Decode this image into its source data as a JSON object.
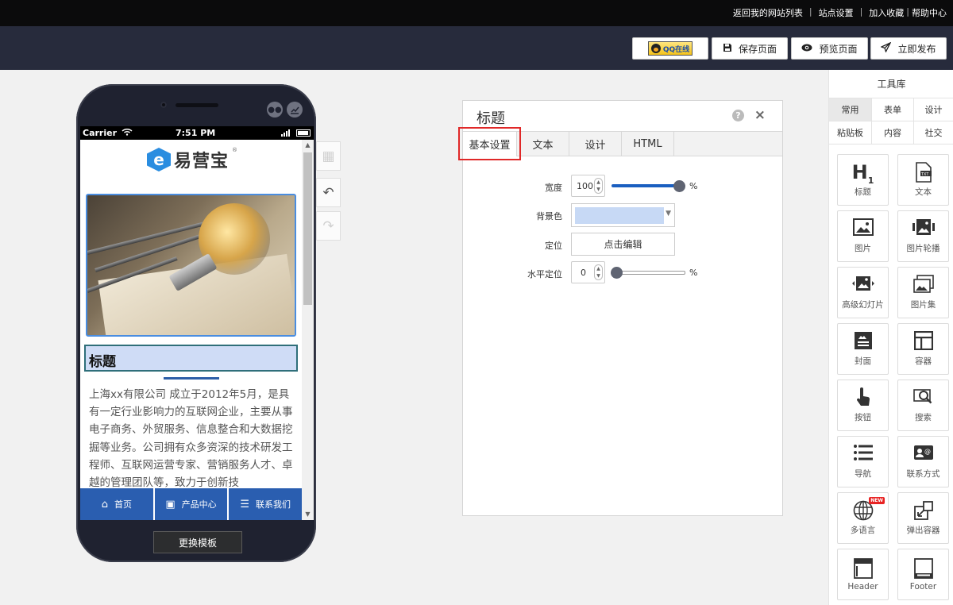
{
  "topbar": {
    "links": [
      "返回我的网站列表",
      "站点设置",
      "加入收藏",
      "帮助中心"
    ]
  },
  "navbar": {
    "qq_label": "QQ在线",
    "save_label": "保存页面",
    "preview_label": "预览页面",
    "publish_label": "立即发布"
  },
  "phone": {
    "carrier": "Carrier",
    "time": "7:51 PM",
    "logo_text": "易营宝",
    "logo_reg": "®",
    "title": "标题",
    "body": "上海xx有限公司 成立于2012年5月，是具有一定行业影响力的互联网企业，主要从事电子商务、外贸服务、信息整合和大数据挖掘等业务。公司拥有众多资深的技术研发工程师、互联网运营专家、营销服务人才、卓越的管理团队等，致力于创新技",
    "tabs": [
      {
        "label": "首页",
        "icon": "home-icon"
      },
      {
        "label": "产品中心",
        "icon": "gallery-icon"
      },
      {
        "label": "联系我们",
        "icon": "list-icon"
      }
    ],
    "change_template_label": "更换模板"
  },
  "panel": {
    "title": "标题",
    "tabs": [
      "基本设置",
      "文本",
      "设计",
      "HTML"
    ],
    "active_tab": "基本设置",
    "width_label": "宽度",
    "width_value": "100",
    "width_unit": "%",
    "width_level": 1.0,
    "bg_label": "背景色",
    "bg_color": "#c7d9f5",
    "position_label": "定位",
    "edit_label": "点击编辑",
    "hpos_label": "水平定位",
    "hpos_value": "0",
    "hpos_unit": "%",
    "hpos_level": 0.0
  },
  "toolbox": {
    "title": "工具库",
    "categories": [
      "常用",
      "表单",
      "设计",
      "粘贴板",
      "内容",
      "社交"
    ],
    "active_category": "常用",
    "tools": [
      {
        "label": "标题",
        "icon": "heading-icon"
      },
      {
        "label": "文本",
        "icon": "text-icon"
      },
      {
        "label": "图片",
        "icon": "image-icon"
      },
      {
        "label": "图片轮播",
        "icon": "carousel-icon"
      },
      {
        "label": "高级幻灯片",
        "icon": "slideshow-icon"
      },
      {
        "label": "图片集",
        "icon": "gallery-icon"
      },
      {
        "label": "封面",
        "icon": "cover-icon"
      },
      {
        "label": "容器",
        "icon": "container-icon"
      },
      {
        "label": "按钮",
        "icon": "pointer-icon"
      },
      {
        "label": "搜索",
        "icon": "search-icon"
      },
      {
        "label": "导航",
        "icon": "nav-icon"
      },
      {
        "label": "联系方式",
        "icon": "contact-icon"
      },
      {
        "label": "多语言",
        "icon": "globe-icon",
        "badge": "NEW"
      },
      {
        "label": "弹出容器",
        "icon": "popup-icon"
      },
      {
        "label": "Header",
        "icon": "header-icon"
      },
      {
        "label": "Footer",
        "icon": "footer-icon"
      }
    ]
  },
  "colors": {
    "topbar": "#0b0b0c",
    "navbar": "#272b3c",
    "accent": "#2a5eb0",
    "slider": "#1a5fc0",
    "highlight_frame": "#e02828"
  }
}
